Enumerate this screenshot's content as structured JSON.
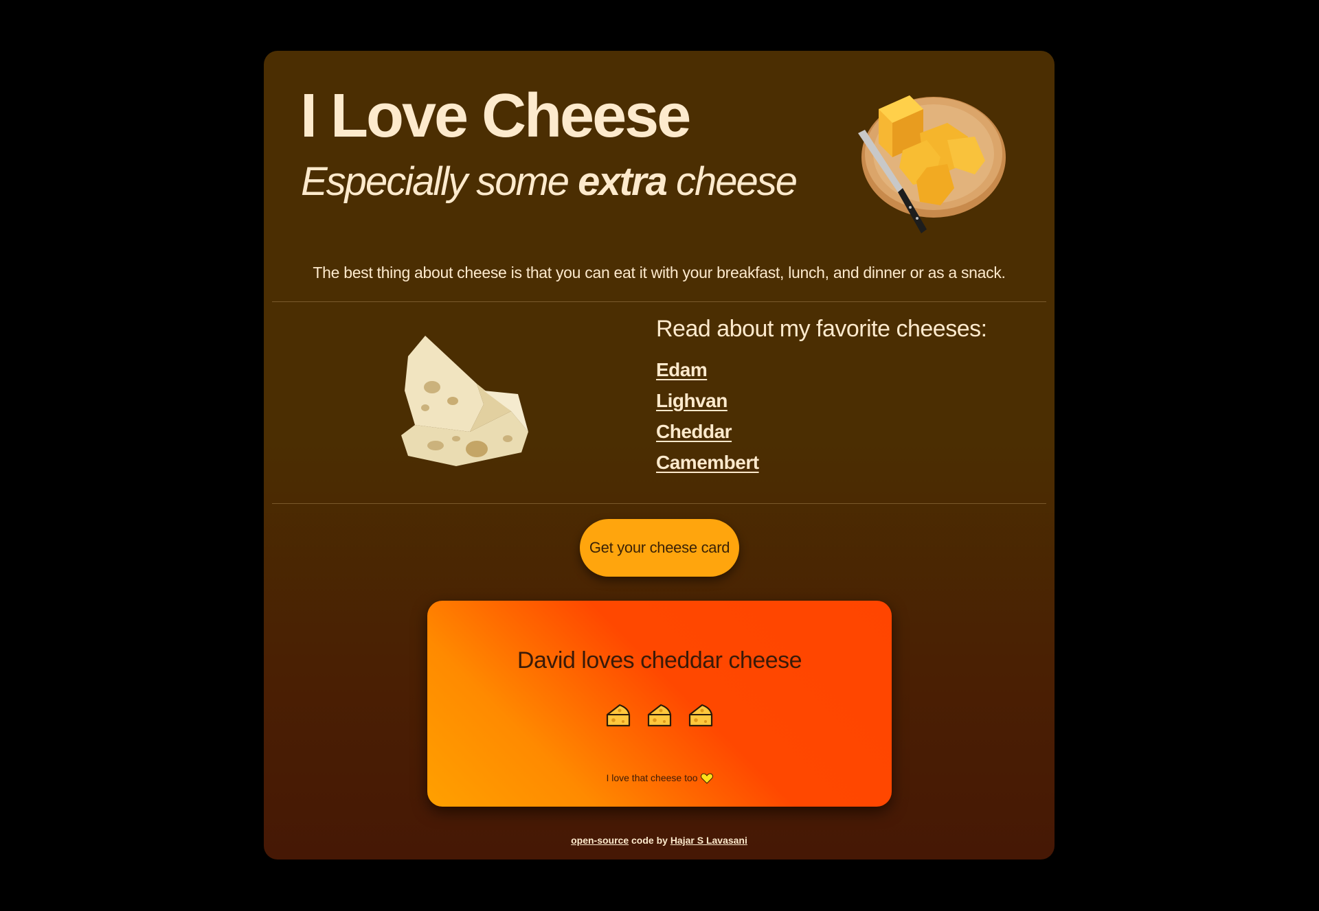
{
  "header": {
    "title": "I Love Cheese",
    "subtitle_pre": "Especially some ",
    "subtitle_bold": "extra",
    "subtitle_post": " cheese"
  },
  "intro": "The best thing about cheese is that you can eat it with your breakfast, lunch, and dinner or as a snack.",
  "favorites": {
    "heading": "Read about my favorite cheeses:",
    "links": [
      "Edam",
      "Lighvan",
      "Cheddar",
      "Camembert"
    ]
  },
  "cta": {
    "label": "Get your cheese card"
  },
  "card": {
    "title": "David loves cheddar cheese",
    "icon_count": 3,
    "icon": "cheese-wedge-icon",
    "note": "I love that cheese too",
    "note_icon": "heart-icon"
  },
  "footer": {
    "link1": "open-source",
    "middle": " code by ",
    "link2": "Hajar S Lavasani"
  },
  "colors": {
    "page_bg": "#000000",
    "panel_top": "#4b2e02",
    "panel_bottom": "#461805",
    "text_cream": "#fdeacd",
    "button": "#ffa50d",
    "card_orange_red": "#ff4500",
    "card_orange_yellow": "#ffa000"
  }
}
